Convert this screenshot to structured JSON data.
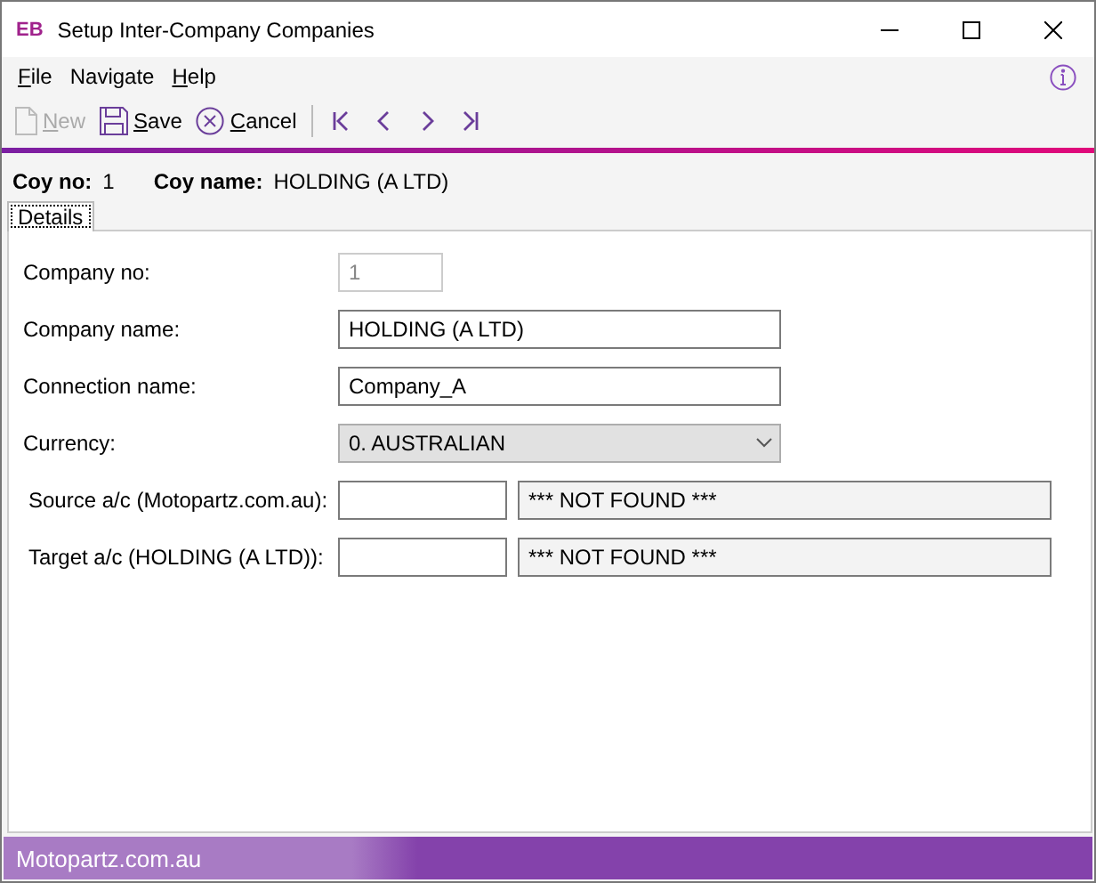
{
  "window": {
    "title": "Setup Inter-Company Companies",
    "logo": "EB"
  },
  "menu": [
    {
      "label": "File",
      "underline_first": true
    },
    {
      "label": "Navigate",
      "underline_first": false
    },
    {
      "label": "Help",
      "underline_first": true
    }
  ],
  "toolbar": [
    {
      "kind": "new",
      "label": "New",
      "disabled": true
    },
    {
      "kind": "save",
      "label": "Save",
      "disabled": false
    },
    {
      "kind": "cancel",
      "label": "Cancel",
      "disabled": false
    },
    {
      "kind": "sep"
    },
    {
      "kind": "first"
    },
    {
      "kind": "prev"
    },
    {
      "kind": "next"
    },
    {
      "kind": "last"
    }
  ],
  "header": [
    {
      "label": "Coy no:",
      "value": "1"
    },
    {
      "label": "Coy name:",
      "value": "HOLDING (A LTD)"
    }
  ],
  "tabs": [
    {
      "label": "Details",
      "selected": true
    }
  ],
  "fields": [
    {
      "kind": "small",
      "label": "Company no:",
      "value": "1",
      "disabled": true
    },
    {
      "kind": "text",
      "label": "Company name:",
      "value": "HOLDING (A LTD)"
    },
    {
      "kind": "text",
      "label": "Connection name:",
      "value": "Company_A"
    },
    {
      "kind": "select",
      "label": "Currency:",
      "value": "0. AUSTRALIAN"
    },
    {
      "kind": "account",
      "label": "Source a/c (Motopartz.com.au):",
      "description": "*** NOT FOUND ***"
    },
    {
      "kind": "account",
      "label": "Target a/c (HOLDING (A LTD)):",
      "description": "*** NOT FOUND ***"
    }
  ],
  "status_bar": {
    "text": "Motopartz.com.au"
  }
}
